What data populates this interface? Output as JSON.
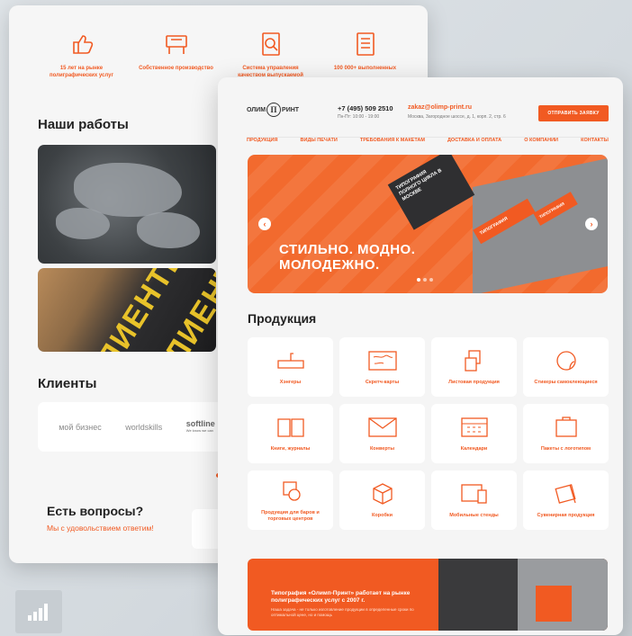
{
  "colors": {
    "accent": "#f15a22",
    "dark": "#2f2f31"
  },
  "mobile": {
    "features": [
      {
        "icon": "thumbs-up-icon",
        "text": "15 лет на рынке полиграфических услуг"
      },
      {
        "icon": "printer-icon",
        "text": "Собственное производство"
      },
      {
        "icon": "quality-search-icon",
        "text": "Система управления качеством выпускаемой"
      },
      {
        "icon": "checklist-icon",
        "text": "100 000+ выполненных"
      }
    ],
    "works_title": "Наши работы",
    "clients_image_word": "КЛИЕНТЫ",
    "clients_title": "Клиенты",
    "client_logos": [
      "мой бизнес",
      "worldskills",
      "softline"
    ],
    "softline_tagline": "We know we can",
    "questions_title": "Есть вопросы?",
    "questions_sub": "Мы с удовольствием ответим!"
  },
  "desktop": {
    "logo_left": "ОЛИМ",
    "logo_mono": "П",
    "logo_right": "РИНТ",
    "phone": "+7 (495) 509 2510",
    "hours": "Пн-Пт: 10:00 - 19:00",
    "email": "zakaz@olimp-print.ru",
    "address": "Москва, Загородное шоссе, д. 1, корп. 2, стр. 6",
    "send_button": "ОТПРАВИТЬ ЗАЯВКУ",
    "nav": [
      "ПРОДУКЦИЯ",
      "ВИДЫ ПЕЧАТИ",
      "ТРЕБОВАНИЯ К МАКЕТАМ",
      "ДОСТАВКА И ОПЛАТА",
      "О КОМПАНИИ",
      "КОНТАКТЫ"
    ],
    "hero": {
      "line1": "СТИЛЬНО. МОДНО.",
      "line2": "МОЛОДЕЖНО.",
      "card_text": "ТИПОГРАФИЯ ПОЛНОГО ЦИКЛА В МОСКВЕ",
      "box_text1": "ТИПОГРАФИЯ",
      "box_text2": "ТИПОГРАФИЯ",
      "prev": "‹",
      "next": "›"
    },
    "products_title": "Продукция",
    "products": [
      {
        "icon": "hanger-icon",
        "label": "Хэнгеры"
      },
      {
        "icon": "scratch-map-icon",
        "label": "Скретч-карты"
      },
      {
        "icon": "sheets-icon",
        "label": "Листовая продукция"
      },
      {
        "icon": "sticker-icon",
        "label": "Стикеры самоклеющиеся"
      },
      {
        "icon": "book-icon",
        "label": "Книги, журналы"
      },
      {
        "icon": "envelope-icon",
        "label": "Конверты"
      },
      {
        "icon": "calendar-icon",
        "label": "Календари"
      },
      {
        "icon": "bag-icon",
        "label": "Пакеты с логотипом"
      },
      {
        "icon": "pos-icon",
        "label": "Продукция для баров и торговых центров"
      },
      {
        "icon": "box-icon",
        "label": "Коробки"
      },
      {
        "icon": "stand-icon",
        "label": "Мобильные стенды"
      },
      {
        "icon": "souvenir-icon",
        "label": "Сувенирная продукция"
      }
    ],
    "about_title": "Типография «Олимп-Принт» работает на рынке полиграфических услуг с 2007 г.",
    "about_text": "Наша задача - не только изготовление продукции в определенные сроки по оптимальной цене, но и помощь"
  }
}
